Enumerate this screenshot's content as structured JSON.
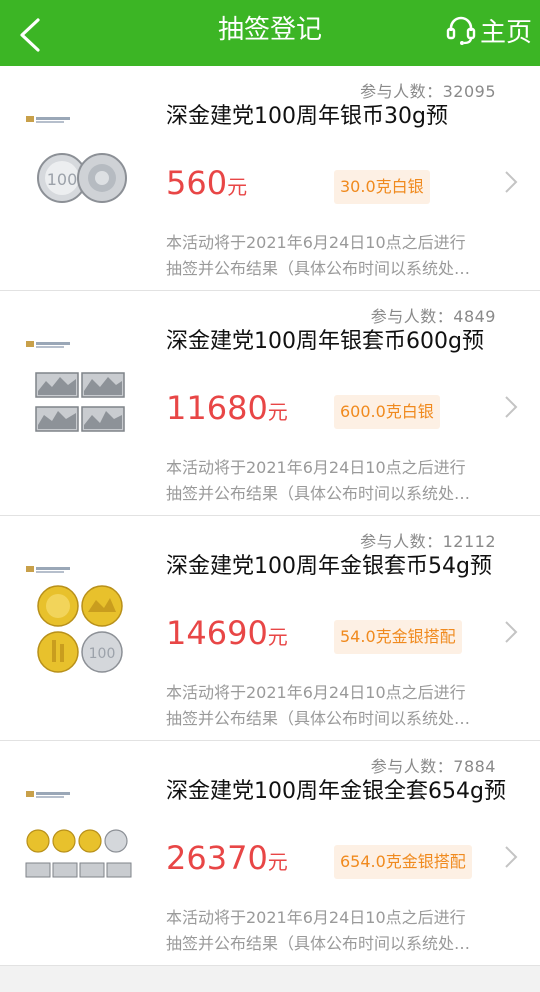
{
  "header": {
    "title": "抽签登记",
    "home_label": "主页"
  },
  "items": [
    {
      "participants": "参与人数：32095",
      "name": "深金建党100周年银币30g预",
      "price": "560",
      "unit": "元",
      "tag": "30.0克白银",
      "desc1": "本活动将于2021年6月24日10点之后进行",
      "desc2": "抽签并公布结果（具体公布时间以系统处…"
    },
    {
      "participants": "参与人数：4849",
      "name": "深金建党100周年银套币600g预",
      "price": "11680",
      "unit": "元",
      "tag": "600.0克白银",
      "desc1": "本活动将于2021年6月24日10点之后进行",
      "desc2": "抽签并公布结果（具体公布时间以系统处…"
    },
    {
      "participants": "参与人数：12112",
      "name": "深金建党100周年金银套币54g预",
      "price": "14690",
      "unit": "元",
      "tag": "54.0克金银搭配",
      "desc1": "本活动将于2021年6月24日10点之后进行",
      "desc2": "抽签并公布结果（具体公布时间以系统处…"
    },
    {
      "participants": "参与人数：7884",
      "name": "深金建党100周年金银全套654g预",
      "price": "26370",
      "unit": "元",
      "tag": "654.0克金银搭配",
      "desc1": "本活动将于2021年6月24日10点之后进行",
      "desc2": "抽签并公布结果（具体公布时间以系统处…"
    }
  ],
  "colors": {
    "header_green": "#3cb525",
    "price_red": "#e84646",
    "tag_orange": "#f08a1e"
  }
}
